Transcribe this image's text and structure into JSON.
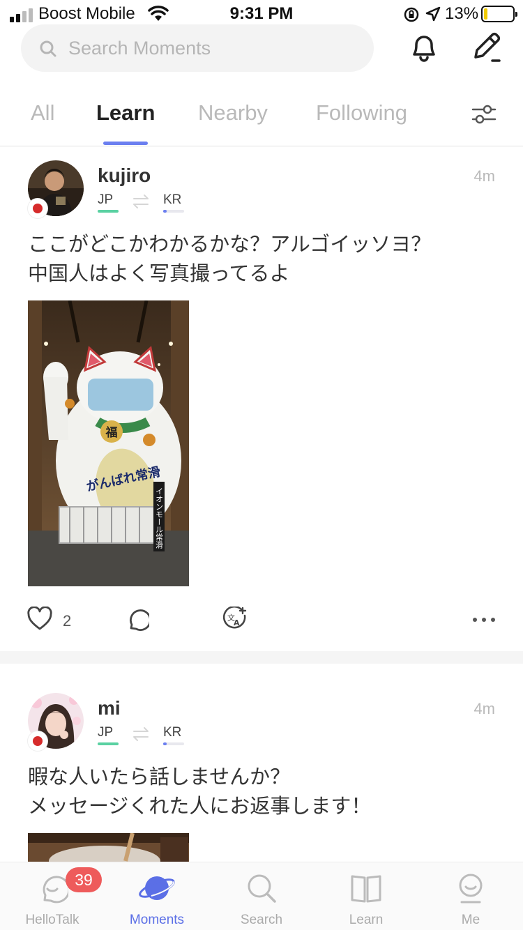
{
  "status_bar": {
    "carrier": "Boost Mobile",
    "time": "9:31 PM",
    "battery_percent": "13%",
    "battery_level": 0.13,
    "signal_bars_filled": 2,
    "signal_bars_total": 4
  },
  "header": {
    "search_placeholder": "Search Moments",
    "notification_icon": "bell-icon",
    "compose_icon": "pencil-icon"
  },
  "tabs": [
    {
      "label": "All",
      "active": false
    },
    {
      "label": "Learn",
      "active": true
    },
    {
      "label": "Nearby",
      "active": false
    },
    {
      "label": "Following",
      "active": false
    }
  ],
  "posts": [
    {
      "username": "kujiro",
      "time": "4m",
      "native_language": "JP",
      "learning_language": "KR",
      "learning_level": 0.15,
      "text_lines": [
        "ここがどこかわかるかな？アルゴイッソヨ？",
        "中国人はよく写真撮ってるよ"
      ],
      "photo_sign_text": "がんばれ常滑",
      "photo_side_text": "イオンモール常滑",
      "photo_coin_text": "福",
      "likes": "2"
    },
    {
      "username": "mi",
      "time": "4m",
      "native_language": "JP",
      "learning_language": "KR",
      "learning_level": 0.15,
      "text_lines": [
        "暇な人いたら話しませんか？",
        "メッセージくれた人にお返事します！"
      ]
    }
  ],
  "bottom_nav": [
    {
      "label": "HelloTalk",
      "badge": "39",
      "active": false
    },
    {
      "label": "Moments",
      "active": true
    },
    {
      "label": "Search",
      "active": false
    },
    {
      "label": "Learn",
      "active": false
    },
    {
      "label": "Me",
      "active": false
    }
  ],
  "colors": {
    "accent": "#6b7ff0",
    "native_bar": "#5ad1a2",
    "badge": "#ee5b5b",
    "battery": "#f2cc00",
    "flag_red": "#d62b2b"
  }
}
